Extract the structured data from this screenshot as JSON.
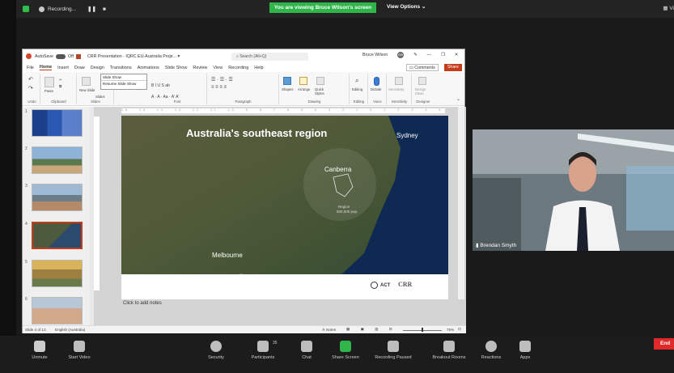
{
  "zoom_top": {
    "recording_label": "Recording...",
    "pause_symbol": "❚❚",
    "stop_symbol": "■",
    "viewing_banner": "You are viewing Bruce Wilson's screen",
    "view_options": "View Options ⌄",
    "view_label": "Vi"
  },
  "ppt": {
    "autosave": "AutoSave",
    "toggle_state": "Off",
    "title": "CRR Presentation · IQRC EU-Australia Proje... ▾",
    "search_placeholder": "Search (Alt+Q)",
    "user_name": "Bruce Wilson",
    "avatar_initials": "BW",
    "window_min": "—",
    "window_restore": "❐",
    "window_close": "✕",
    "menu": [
      "File",
      "Home",
      "Insert",
      "Draw",
      "Design",
      "Transitions",
      "Animations",
      "Slide Show",
      "Review",
      "View",
      "Recording",
      "Help"
    ],
    "comments": "Comments",
    "share": "Share",
    "ribbon_groups": [
      "Undo",
      "Clipboard",
      "Slides",
      "Font",
      "Paragraph",
      "Drawing",
      "Editing",
      "Voice",
      "Sensitivity",
      "Designer"
    ],
    "ribbon_buttons": {
      "paste": "Paste",
      "new_slide": "New Slide",
      "slides": "Slides",
      "shapes": "Shapes",
      "arrange": "Arrange",
      "quick_styles": "Quick Styles",
      "editing": "Editing",
      "dictate": "Dictate",
      "sensitivity": "Sensitivity",
      "design_ideas": "Design Ideas"
    },
    "slideshow_dropdown": {
      "item1": "Slide Show",
      "item2": "Resume Slide Show"
    },
    "slide": {
      "title": "Australia's southeast region",
      "cities": [
        "Sydney",
        "Canberra",
        "Melbourne"
      ],
      "region_label": "Region",
      "population_label": "500,000 pop.",
      "logo_act": "ACT",
      "logo_crr": "CRR"
    },
    "notes_placeholder": "Click to add notes",
    "ruler_text": "16 · 15 · 14 · 13 · 12 · 11 · 10 · 9 · 8 · 7 · 6 · 5 · 4 · 3 · 2 · 1 · 0 · 1 · 2 · 3 · 4 · 5 · 6 · 7 · 8 · 9 · 10 · 11 · 12 · 13 · 14 · 15 · 16",
    "slide_numbers": [
      "1",
      "2",
      "3",
      "4",
      "5",
      "6"
    ],
    "status_slide": "Slide 4 of 13",
    "status_language": "English (Australia)",
    "status_notes": "Notes",
    "zoom_level": "75%"
  },
  "video": {
    "participant_name": "Brendan Smyth"
  },
  "toolbar": {
    "items": [
      "Unmute",
      "Start Video",
      "Security",
      "Participants",
      "Chat",
      "Share Screen",
      "Recording Paused",
      "Breakout Rooms",
      "Reactions",
      "Apps"
    ],
    "participants_count": "35",
    "end": "End"
  },
  "colors": {
    "zoom_bg": "#1a1a1a",
    "banner_green": "#2fb54a",
    "ppt_accent": "#c43e1c",
    "end_red": "#e02a2a"
  }
}
